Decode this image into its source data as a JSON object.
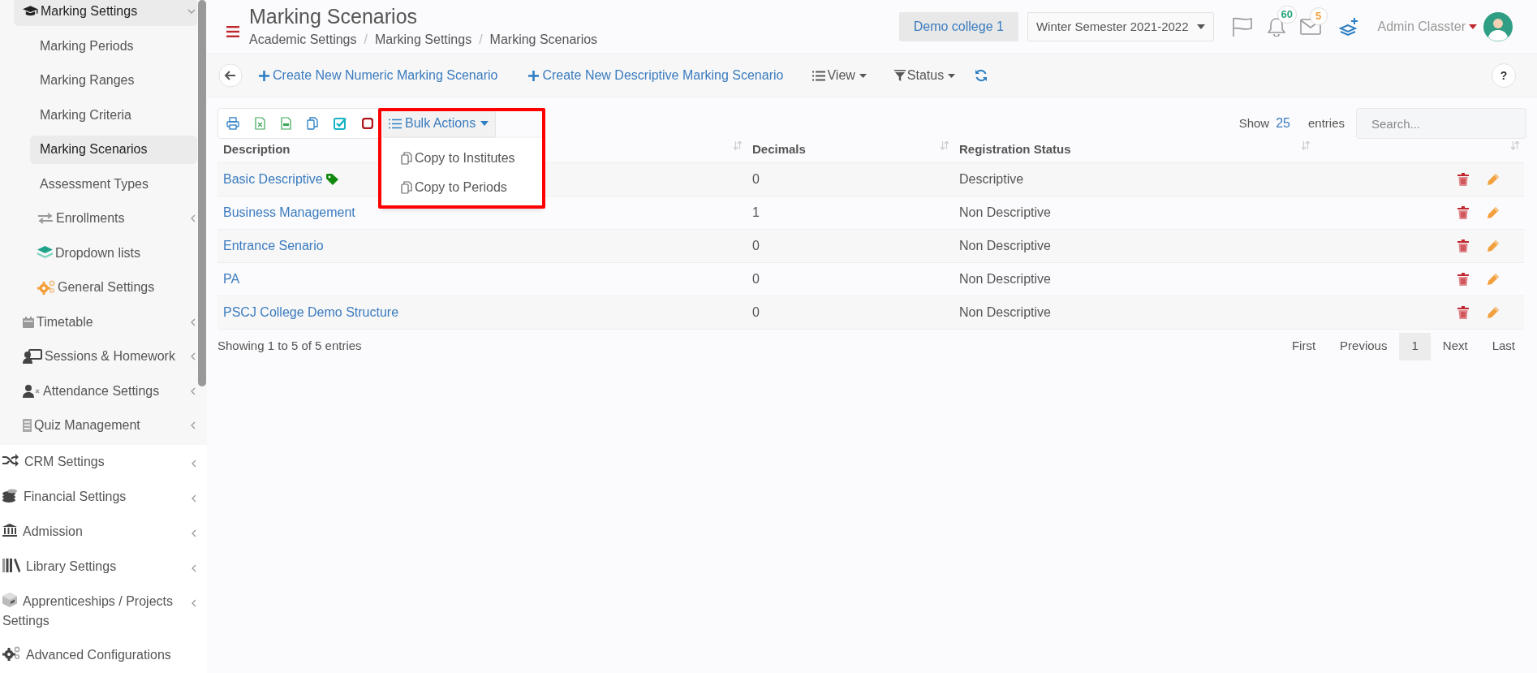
{
  "topbar": {
    "title": "Marking Scenarios",
    "breadcrumb": [
      "Academic Settings",
      "Marking Settings",
      "Marking Scenarios"
    ],
    "breadcrumb_separator": "/",
    "institute": "Demo college 1",
    "semester": "Winter Semester 2021-2022",
    "notifications": "60",
    "messages": "5",
    "user": "Admin Classter"
  },
  "sidebar": {
    "section_items": [
      {
        "label": "Marking Settings",
        "selected": true,
        "expanded": true,
        "children": [
          {
            "kind": "link",
            "label": "Marking Periods",
            "selected": false
          },
          {
            "kind": "link",
            "label": "Marking Ranges",
            "selected": false
          },
          {
            "kind": "link",
            "label": "Marking Criteria",
            "selected": false
          },
          {
            "kind": "link",
            "label": "Marking Scenarios",
            "selected": true
          },
          {
            "kind": "link",
            "label": "Assessment Types",
            "selected": false
          },
          {
            "kind": "icon_link",
            "label": "Enrollments",
            "selected": false,
            "expanded": false
          },
          {
            "kind": "icon_link",
            "label": "Dropdown lists",
            "selected": false
          },
          {
            "kind": "icon_link",
            "label": "General Settings",
            "selected": false
          }
        ]
      },
      {
        "label": "Timetable",
        "selected": false,
        "expanded": false
      },
      {
        "label": "Sessions & Homework",
        "selected": false,
        "expanded": false
      },
      {
        "label": "Attendance Settings",
        "selected": false,
        "expanded": false
      },
      {
        "label": "Quiz Management",
        "selected": false,
        "expanded": false
      }
    ],
    "items": [
      {
        "label": "CRM Settings",
        "selected": false,
        "expanded": false
      },
      {
        "label": "Financial Settings",
        "selected": false,
        "expanded": false
      },
      {
        "label": "Admission",
        "selected": false,
        "expanded": false
      },
      {
        "label": "Library Settings",
        "selected": false,
        "expanded": false
      },
      {
        "label": "Apprenticeships / Projects Settings",
        "selected": false,
        "expanded": false
      },
      {
        "label": "Advanced Configurations",
        "selected": false
      }
    ]
  },
  "toolbar": {
    "actions": [
      "Create New Numeric Marking Scenario",
      "Create New Descriptive Marking Scenario"
    ],
    "menus": [
      "View",
      "Status"
    ],
    "help": "?"
  },
  "table": {
    "bulk_actions": {
      "label": "Bulk Actions",
      "expanded": true,
      "highlighted": true,
      "items": [
        "Copy to Institutes",
        "Copy to Periods"
      ]
    },
    "show_label": "Show",
    "page_size": "25",
    "entries_label": "entries",
    "search": {
      "placeholder": "Search..."
    },
    "columns": [
      "Description",
      "Decimals",
      "Registration Status"
    ],
    "rows": [
      {
        "description": "Basic Descriptive",
        "tagged": true,
        "decimals": "0",
        "registration_status": "Descriptive"
      },
      {
        "description": "Business Management",
        "tagged": false,
        "decimals": "1",
        "registration_status": "Non Descriptive"
      },
      {
        "description": "Entrance Senario",
        "tagged": false,
        "decimals": "0",
        "registration_status": "Non Descriptive"
      },
      {
        "description": "PA",
        "tagged": false,
        "decimals": "0",
        "registration_status": "Non Descriptive"
      },
      {
        "description": "PSCJ College Demo Structure",
        "tagged": false,
        "decimals": "0",
        "registration_status": "Non Descriptive"
      }
    ],
    "info": "Showing 1 to 5 of 5 entries",
    "pagination": [
      {
        "label": "First",
        "selected": false
      },
      {
        "label": "Previous",
        "selected": false
      },
      {
        "label": "1",
        "selected": true
      },
      {
        "label": "Next",
        "selected": false
      },
      {
        "label": "Last",
        "selected": false
      }
    ]
  }
}
